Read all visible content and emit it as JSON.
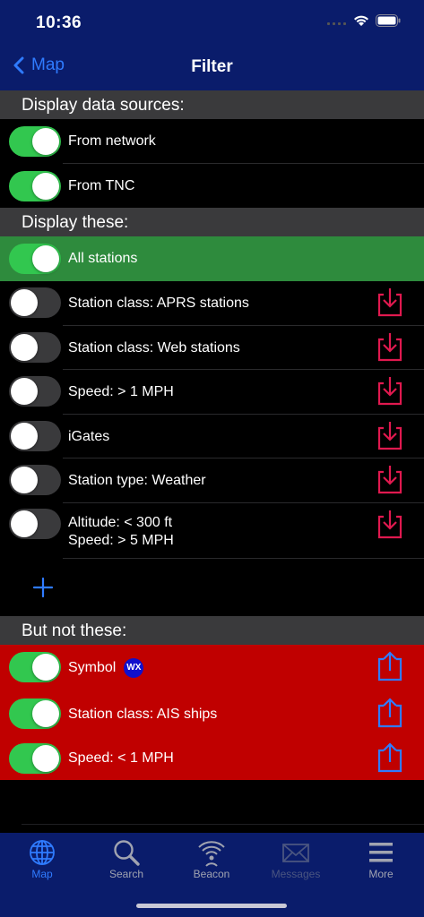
{
  "status": {
    "time": "10:36"
  },
  "nav": {
    "back_label": "Map",
    "title": "Filter"
  },
  "sections": {
    "sources": "Display data sources:",
    "display": "Display these:",
    "exclude": "But not these:"
  },
  "sources": [
    {
      "label": "From network",
      "on": true
    },
    {
      "label": "From TNC",
      "on": true
    }
  ],
  "display_items": [
    {
      "label": "All stations",
      "on": true
    },
    {
      "label": "Station class: APRS stations",
      "on": false
    },
    {
      "label": "Station class: Web stations",
      "on": false
    },
    {
      "label": "Speed: > 1 MPH",
      "on": false
    },
    {
      "label": "iGates",
      "on": false
    },
    {
      "label": "Station type: Weather",
      "on": false
    },
    {
      "label_line1": "Altitude: < 300 ft",
      "label_line2": "Speed: > 5 MPH",
      "on": false
    }
  ],
  "exclude_items": [
    {
      "label": "Symbol",
      "badge": "WX",
      "on": true
    },
    {
      "label": "Station class: AIS ships",
      "on": true
    },
    {
      "label": "Speed: < 1 MPH",
      "on": true
    }
  ],
  "tabs": [
    {
      "label": "Map",
      "icon": "globe-icon",
      "active": true
    },
    {
      "label": "Search",
      "icon": "magnifier-icon",
      "active": false
    },
    {
      "label": "Beacon",
      "icon": "broadcast-icon",
      "active": false
    },
    {
      "label": "Messages",
      "icon": "envelope-icon",
      "active": false,
      "disabled": true
    },
    {
      "label": "More",
      "icon": "menu-icon",
      "active": false
    }
  ],
  "colors": {
    "bar": "#0a1c6b",
    "accent": "#2f7bff",
    "toggle_on": "#32c74f",
    "all_stations_bg": "#2e8b3d",
    "exclude_bg": "#c00000",
    "import_icon": "#e0194f",
    "export_icon": "#2f7bff"
  }
}
